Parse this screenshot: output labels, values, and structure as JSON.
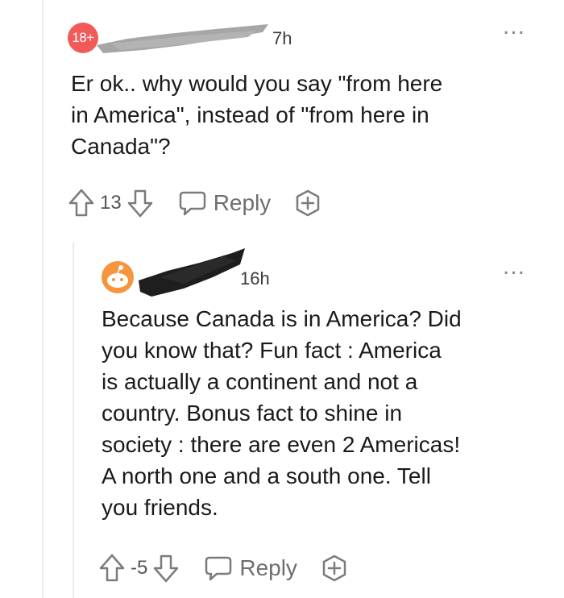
{
  "parent": {
    "avatar_text": "18+",
    "age": "7h",
    "more_menu": "...",
    "body": "Er ok.. why would you say \"from here\nin America\", instead of \"from here in\nCanada\"?",
    "score": "13",
    "reply_label": "Reply"
  },
  "child": {
    "age": "16h",
    "more_menu": "...",
    "body": "Because Canada is in America? Did\nyou know that? Fun fact : America\nis actually a continent and not a\ncountry. Bonus fact to shine in\nsociety : there are even 2 Americas!\nA north one and a south one. Tell\nyou friends.",
    "score": "-5",
    "reply_label": "Reply"
  },
  "icons": {
    "upvote": "arrow-up-icon",
    "downvote": "arrow-down-icon",
    "reply": "speech-bubble-icon",
    "award": "plus-icon",
    "more": "more-dots-icon",
    "avatar": "reddit-snoo-icon"
  },
  "colors": {
    "avatar_red": "#f25a5a",
    "snoo_orange": "#f6953d",
    "redaction_grey": "#a6a6a6",
    "redaction_black": "#1e1e1e",
    "icon_grey": "#7b7b7b"
  }
}
